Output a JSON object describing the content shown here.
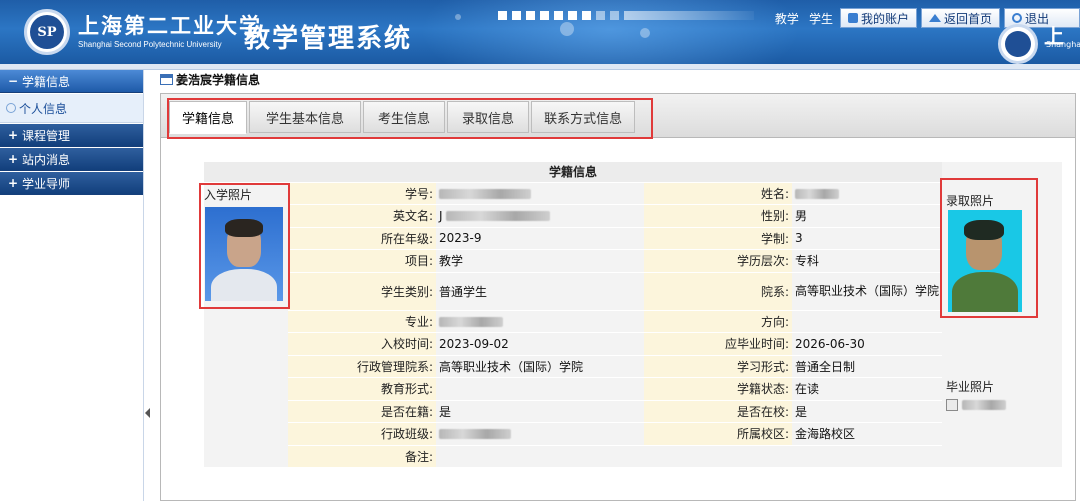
{
  "header": {
    "university_cn": "上海第二工业大学",
    "university_en": "Shanghai Second Polytechnic University",
    "system_title": "教学管理系统",
    "logo_text": "SP",
    "role_teacher": "教学",
    "role_student": "学生",
    "my_account": "我的账户",
    "back_home": "返回首页",
    "logout": "退出",
    "right_partial_cn": "上",
    "right_partial_en": "Shangha"
  },
  "sidebar": {
    "sections": [
      {
        "label": "学籍信息",
        "sign": "−",
        "expanded": true,
        "children": [
          "个人信息"
        ]
      },
      {
        "label": "课程管理",
        "sign": "+"
      },
      {
        "label": "站内消息",
        "sign": "+"
      },
      {
        "label": "学业导师",
        "sign": "+"
      }
    ]
  },
  "main": {
    "page_title": "姜浩宸学籍信息",
    "tabs": [
      "学籍信息",
      "学生基本信息",
      "考生信息",
      "录取信息",
      "联系方式信息"
    ],
    "active_tab": 0,
    "table": {
      "caption": "学籍信息",
      "entrance_photo_label": "入学照片",
      "admission_photo_label": "录取照片",
      "graduation_photo_label": "毕业照片",
      "rows": [
        {
          "l1": "学号:",
          "v1": "",
          "l2": "姓名:",
          "v2": ""
        },
        {
          "l1": "英文名:",
          "v1": "J",
          "l2": "性别:",
          "v2": "男"
        },
        {
          "l1": "所在年级:",
          "v1": "2023-9",
          "l2": "学制:",
          "v2": "3"
        },
        {
          "l1": "项目:",
          "v1": "教学",
          "l2": "学历层次:",
          "v2": "专科"
        },
        {
          "l1": "学生类别:",
          "v1": "普通学生",
          "l2": "院系:",
          "v2": "高等职业技术（国际）学院"
        },
        {
          "l1": "专业:",
          "v1": "",
          "l2": "方向:",
          "v2": ""
        },
        {
          "l1": "入校时间:",
          "v1": "2023-09-02",
          "l2": "应毕业时间:",
          "v2": "2026-06-30"
        },
        {
          "l1": "行政管理院系:",
          "v1": "高等职业技术（国际）学院",
          "l2": "学习形式:",
          "v2": "普通全日制"
        },
        {
          "l1": "教育形式:",
          "v1": "",
          "l2": "学籍状态:",
          "v2": "在读"
        },
        {
          "l1": "是否在籍:",
          "v1": "是",
          "l2": "是否在校:",
          "v2": "是"
        },
        {
          "l1": "行政班级:",
          "v1": "",
          "l2": "所属校区:",
          "v2": "金海路校区"
        },
        {
          "l1": "备注:",
          "v1": ""
        }
      ]
    }
  },
  "colors": {
    "header_blue": "#1f5ea8",
    "label_bg": "#fcf5dc",
    "value_bg": "#f3f3f3",
    "highlight_red": "#e03a3a",
    "admission_photo_bg": "#19c8e6"
  }
}
